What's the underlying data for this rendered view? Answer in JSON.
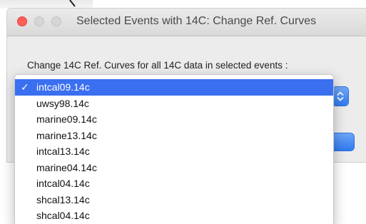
{
  "window": {
    "title": "Selected Events with 14C: Change Ref. Curves"
  },
  "dialog": {
    "prompt": "Change 14C Ref. Curves for all 14C data in selected events :"
  },
  "menu": {
    "checkmark": "✓",
    "items": [
      {
        "label": "intcal09.14c",
        "selected": true
      },
      {
        "label": "uwsy98.14c",
        "selected": false
      },
      {
        "label": "marine09.14c",
        "selected": false
      },
      {
        "label": "marine13.14c",
        "selected": false
      },
      {
        "label": "intcal13.14c",
        "selected": false
      },
      {
        "label": "marine04.14c",
        "selected": false
      },
      {
        "label": "intcal04.14c",
        "selected": false
      },
      {
        "label": "shcal13.14c",
        "selected": false
      },
      {
        "label": "shcal04.14c",
        "selected": false
      }
    ]
  },
  "colors": {
    "close_button": "#fc5f57",
    "inactive_button": "#d6d6d6",
    "selection": "#3a6ff0",
    "accent_button": "#2f7af0",
    "window_background": "#ececec"
  },
  "icons": {
    "popup_arrows": "up-down-chevron-icon",
    "selected_check": "checkmark-icon"
  }
}
